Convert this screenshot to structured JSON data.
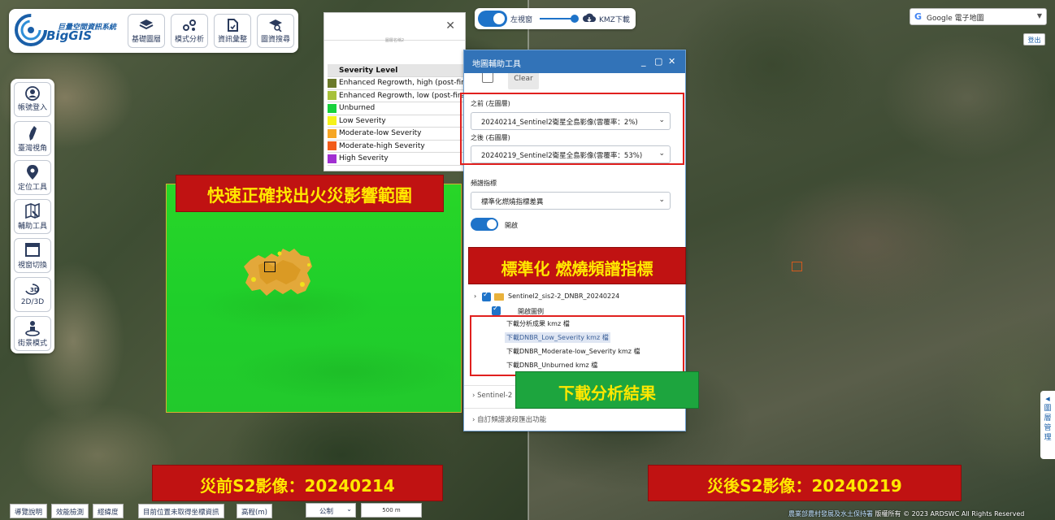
{
  "logo": {
    "cn": "巨量空間資訊系統",
    "en": "BigGIS"
  },
  "toolbar": [
    {
      "label": "基礎圖層",
      "icon": "layers-icon"
    },
    {
      "label": "模式分析",
      "icon": "analysis-icon"
    },
    {
      "label": "資訊彙整",
      "icon": "document-icon"
    },
    {
      "label": "圖資搜尋",
      "icon": "map-search-icon"
    }
  ],
  "sidebar": [
    {
      "label": "帳號登入",
      "icon": "user-icon"
    },
    {
      "label": "臺灣視角",
      "icon": "taiwan-icon"
    },
    {
      "label": "定位工具",
      "icon": "location-pin-icon"
    },
    {
      "label": "輔助工具",
      "icon": "map-tool-icon"
    },
    {
      "label": "視窗切換",
      "icon": "window-icon"
    },
    {
      "label": "2D/3D",
      "icon": "3d-icon"
    },
    {
      "label": "街景模式",
      "icon": "street-view-icon"
    }
  ],
  "legend": {
    "subtitle": "圖層名稱2",
    "title": "Severity Level",
    "items": [
      {
        "label": "Enhanced Regrowth, high (post-fire)",
        "color": "#6b7a2a"
      },
      {
        "label": "Enhanced Regrowth, low (post-fire)",
        "color": "#a7c13a"
      },
      {
        "label": "Unburned",
        "color": "#17d23c"
      },
      {
        "label": "Low Severity",
        "color": "#f5f219"
      },
      {
        "label": "Moderate-low Severity",
        "color": "#f6a623"
      },
      {
        "label": "Moderate-high Severity",
        "color": "#f25c1a"
      },
      {
        "label": "High Severity",
        "color": "#a12fd1"
      }
    ]
  },
  "compare": {
    "left_label": "左視窗",
    "kmz_label": "KMZ下載"
  },
  "tools": {
    "title": "地圖輔助工具",
    "clear": "Clear",
    "before_label": "之前 (左圖層)",
    "before_value": "20240214_Sentinel2衛星全島影像(雲覆率：2%)",
    "after_label": "之後 (右圖層)",
    "after_value": "20240219_Sentinel2衛星全島影像(雲覆率：53%)",
    "index_label": "頻譜指標",
    "index_value": "標準化燃燒指標差異",
    "switch_label": "開啟",
    "layer_name": "Sentinel2_sis2-2_DNBR_20240224",
    "legend_toggle": "開啟圖例",
    "downloads": [
      "下載分析成果 kmz 檔",
      "下載DNBR_Low_Severity kmz 檔",
      "下載DNBR_Moderate-low_Severity kmz 檔",
      "下載DNBR_Unburned kmz 檔"
    ],
    "section_sentinel": "Sentinel-2",
    "section_custom": "自訂頻譜波段匯出功能"
  },
  "annotations": {
    "fire_range": "快速正確找出火災影響範圍",
    "dnbr": "標準化 燃燒頻譜指標",
    "download": "下載分析結果",
    "before": "災前S2影像：20240214",
    "after": "災後S2影像：20240219"
  },
  "basemap": {
    "value": "Google 電子地圖"
  },
  "logout": "登出",
  "right_tab": [
    "圖",
    "層",
    "管",
    "理"
  ],
  "bottom": {
    "buttons": [
      "導覽說明",
      "效能檢測",
      "經緯度",
      "目前位置未取得坐標資訊",
      "高程(m)"
    ],
    "unit": "公制",
    "scale": "500 m",
    "copyright_org": "農業部農村發展及水土保持署",
    "copyright_text": "版權所有 © 2023 ARDSWC All Rights Reserved"
  },
  "colors": {
    "accent": "#1e73c9",
    "panel_header": "#3273b8",
    "annotation_red": "#c01212",
    "annotation_green": "#1da53e"
  }
}
